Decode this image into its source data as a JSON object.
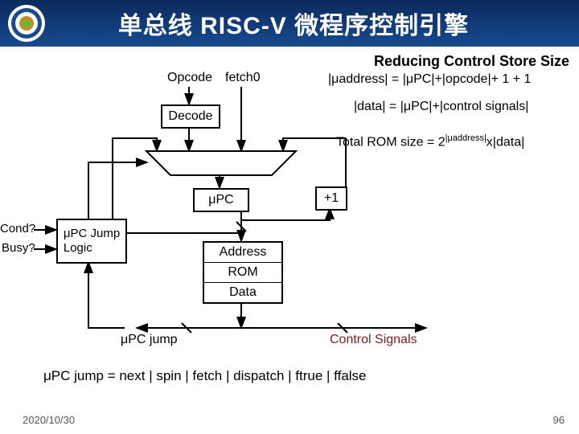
{
  "header": {
    "title": "单总线 RISC-V 微程序控制引擎"
  },
  "subtitle": "Reducing Control Store Size",
  "labels": {
    "opcode": "Opcode",
    "fetch0": "fetch0",
    "decode": "Decode",
    "upc": "μPC",
    "plus1": "+1",
    "cond": "Cond?",
    "busy": "Busy?",
    "jump_logic": "μPC Jump Logic",
    "address": "Address",
    "rom": "ROM",
    "data": "Data",
    "upc_jump": "μPC jump",
    "ctrl": "Control Signals"
  },
  "eq1_pre": "|μaddress| = |μPC|+|opcode|+ 1 + 1",
  "eq2_pre": "|data| = |μPC|+|control signals|",
  "eq3_a": "Total ROM size = 2",
  "eq3_sup": "|μaddress|",
  "eq3_b": "x|data|",
  "formula": "μPC jump = next | spin | fetch | dispatch | ftrue | ffalse",
  "footer": {
    "date": "2020/10/30",
    "page": "96"
  },
  "chart_data": {
    "type": "diagram",
    "title": "单总线 RISC-V 微程序控制引擎 — Reducing Control Store Size",
    "nodes": [
      {
        "id": "opcode_in",
        "label": "Opcode",
        "kind": "input"
      },
      {
        "id": "fetch0_in",
        "label": "fetch0",
        "kind": "input"
      },
      {
        "id": "decode",
        "label": "Decode",
        "kind": "block"
      },
      {
        "id": "mux",
        "label": "mux",
        "kind": "mux"
      },
      {
        "id": "upc",
        "label": "μPC",
        "kind": "register"
      },
      {
        "id": "rom",
        "label": "ROM",
        "kind": "memory",
        "ports": [
          "Address",
          "Data"
        ]
      },
      {
        "id": "plus1",
        "label": "+1",
        "kind": "adder"
      },
      {
        "id": "jump_logic",
        "label": "μPC Jump Logic",
        "kind": "block",
        "inputs": [
          "Cond?",
          "Busy?"
        ]
      },
      {
        "id": "ctrl_out",
        "label": "Control Signals",
        "kind": "output"
      },
      {
        "id": "upc_jump_out",
        "label": "μPC jump",
        "kind": "output"
      }
    ],
    "edges": [
      {
        "from": "opcode_in",
        "to": "decode"
      },
      {
        "from": "decode",
        "to": "mux"
      },
      {
        "from": "fetch0_in",
        "to": "mux"
      },
      {
        "from": "upc",
        "to": "mux",
        "via": "feedback"
      },
      {
        "from": "plus1",
        "to": "mux"
      },
      {
        "from": "mux",
        "to": "upc"
      },
      {
        "from": "upc",
        "to": "rom",
        "port": "Address"
      },
      {
        "from": "upc",
        "to": "plus1"
      },
      {
        "from": "rom",
        "to": "ctrl_out",
        "port": "Data"
      },
      {
        "from": "rom",
        "to": "upc_jump_out",
        "port": "Data"
      },
      {
        "from": "upc_jump_out",
        "to": "jump_logic"
      },
      {
        "from": "jump_logic",
        "to": "mux",
        "role": "select"
      }
    ],
    "equations": [
      "|μaddress| = |μPC| + |opcode| + 1 + 1",
      "|data| = |μPC| + |control signals|",
      "Total ROM size = 2^|μaddress| × |data|"
    ],
    "upc_jump_values": [
      "next",
      "spin",
      "fetch",
      "dispatch",
      "ftrue",
      "ffalse"
    ]
  }
}
